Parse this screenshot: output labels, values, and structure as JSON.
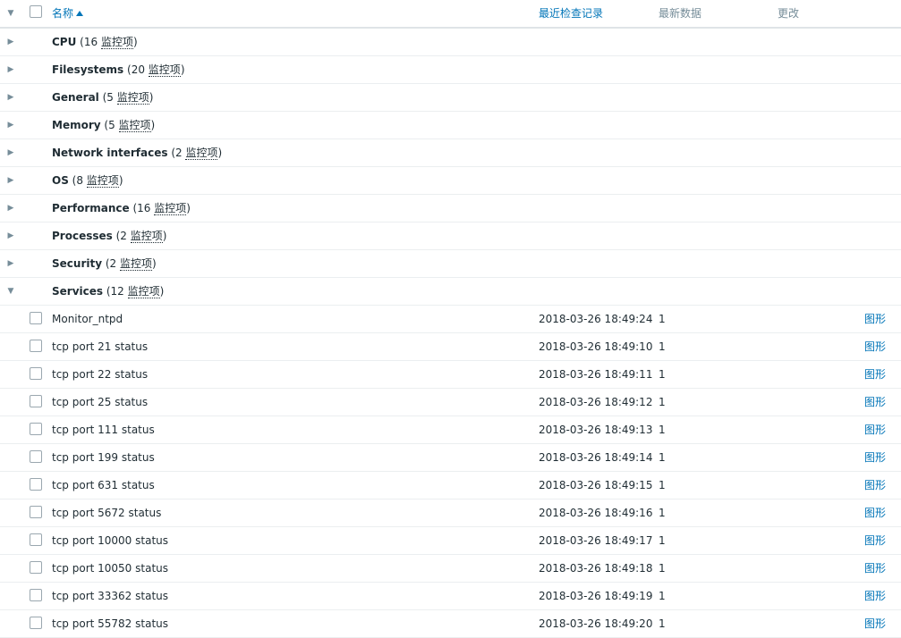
{
  "header": {
    "name_label": "名称",
    "lastcheck_label": "最近检查记录",
    "lastvalue_label": "最新数据",
    "change_label": "更改"
  },
  "icons": {
    "collapsed": "▶",
    "expanded": "▼"
  },
  "applications": [
    {
      "name": "CPU",
      "count_prefix": " (16 ",
      "count_link": "监控项",
      "count_suffix": ")",
      "expanded": false
    },
    {
      "name": "Filesystems",
      "count_prefix": " (20 ",
      "count_link": "监控项",
      "count_suffix": ")",
      "expanded": false
    },
    {
      "name": "General",
      "count_prefix": " (5 ",
      "count_link": "监控项",
      "count_suffix": ")",
      "expanded": false
    },
    {
      "name": "Memory",
      "count_prefix": " (5 ",
      "count_link": "监控项",
      "count_suffix": ")",
      "expanded": false
    },
    {
      "name": "Network interfaces",
      "count_prefix": " (2 ",
      "count_link": "监控项",
      "count_suffix": ")",
      "expanded": false
    },
    {
      "name": "OS",
      "count_prefix": " (8 ",
      "count_link": "监控项",
      "count_suffix": ")",
      "expanded": false
    },
    {
      "name": "Performance",
      "count_prefix": " (16 ",
      "count_link": "监控项",
      "count_suffix": ")",
      "expanded": false
    },
    {
      "name": "Processes",
      "count_prefix": " (2 ",
      "count_link": "监控项",
      "count_suffix": ")",
      "expanded": false
    },
    {
      "name": "Security",
      "count_prefix": " (2 ",
      "count_link": "监控项",
      "count_suffix": ")",
      "expanded": false
    },
    {
      "name": "Services",
      "count_prefix": " (12 ",
      "count_link": "监控项",
      "count_suffix": ")",
      "expanded": true
    }
  ],
  "services_items": [
    {
      "name": "Monitor_ntpd",
      "lastcheck": "2018-03-26 18:49:24",
      "lastvalue": "1",
      "change": "",
      "graph": "图形"
    },
    {
      "name": "tcp port 21 status",
      "lastcheck": "2018-03-26 18:49:10",
      "lastvalue": "1",
      "change": "",
      "graph": "图形"
    },
    {
      "name": "tcp port 22 status",
      "lastcheck": "2018-03-26 18:49:11",
      "lastvalue": "1",
      "change": "",
      "graph": "图形"
    },
    {
      "name": "tcp port 25 status",
      "lastcheck": "2018-03-26 18:49:12",
      "lastvalue": "1",
      "change": "",
      "graph": "图形"
    },
    {
      "name": "tcp port 111 status",
      "lastcheck": "2018-03-26 18:49:13",
      "lastvalue": "1",
      "change": "",
      "graph": "图形"
    },
    {
      "name": "tcp port 199 status",
      "lastcheck": "2018-03-26 18:49:14",
      "lastvalue": "1",
      "change": "",
      "graph": "图形"
    },
    {
      "name": "tcp port 631 status",
      "lastcheck": "2018-03-26 18:49:15",
      "lastvalue": "1",
      "change": "",
      "graph": "图形"
    },
    {
      "name": "tcp port 5672 status",
      "lastcheck": "2018-03-26 18:49:16",
      "lastvalue": "1",
      "change": "",
      "graph": "图形"
    },
    {
      "name": "tcp port 10000 status",
      "lastcheck": "2018-03-26 18:49:17",
      "lastvalue": "1",
      "change": "",
      "graph": "图形"
    },
    {
      "name": "tcp port 10050 status",
      "lastcheck": "2018-03-26 18:49:18",
      "lastvalue": "1",
      "change": "",
      "graph": "图形"
    },
    {
      "name": "tcp port 33362 status",
      "lastcheck": "2018-03-26 18:49:19",
      "lastvalue": "1",
      "change": "",
      "graph": "图形"
    },
    {
      "name": "tcp port 55782 status",
      "lastcheck": "2018-03-26 18:49:20",
      "lastvalue": "1",
      "change": "",
      "graph": "图形"
    }
  ],
  "colors": {
    "link": "#0275b8",
    "muted": "#768d99",
    "text": "#1f2c33",
    "border": "#ebeef0"
  }
}
